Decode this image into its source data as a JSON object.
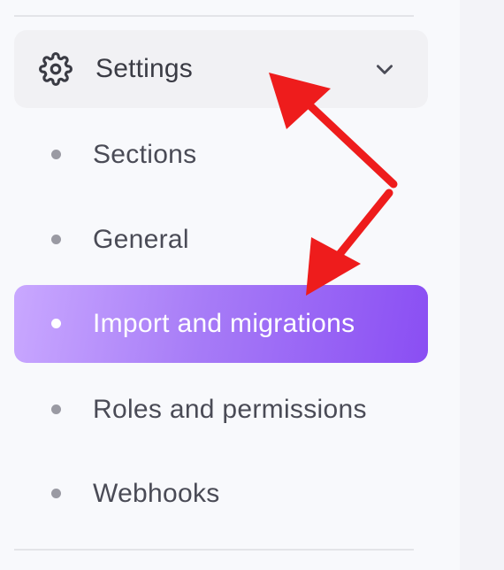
{
  "sidebar": {
    "settings": {
      "label": "Settings",
      "icon": "gear-icon",
      "chevron_icon": "chevron-down-icon",
      "expanded": true
    },
    "items": [
      {
        "label": "Sections",
        "active": false
      },
      {
        "label": "General",
        "active": false
      },
      {
        "label": "Import and migrations",
        "active": true
      },
      {
        "label": "Roles and permissions",
        "active": false
      },
      {
        "label": "Webhooks",
        "active": false
      }
    ]
  },
  "colors": {
    "active_gradient_start": "#c9a8ff",
    "active_gradient_end": "#8a4ef3",
    "annotation_arrow": "#ee1c1c"
  }
}
